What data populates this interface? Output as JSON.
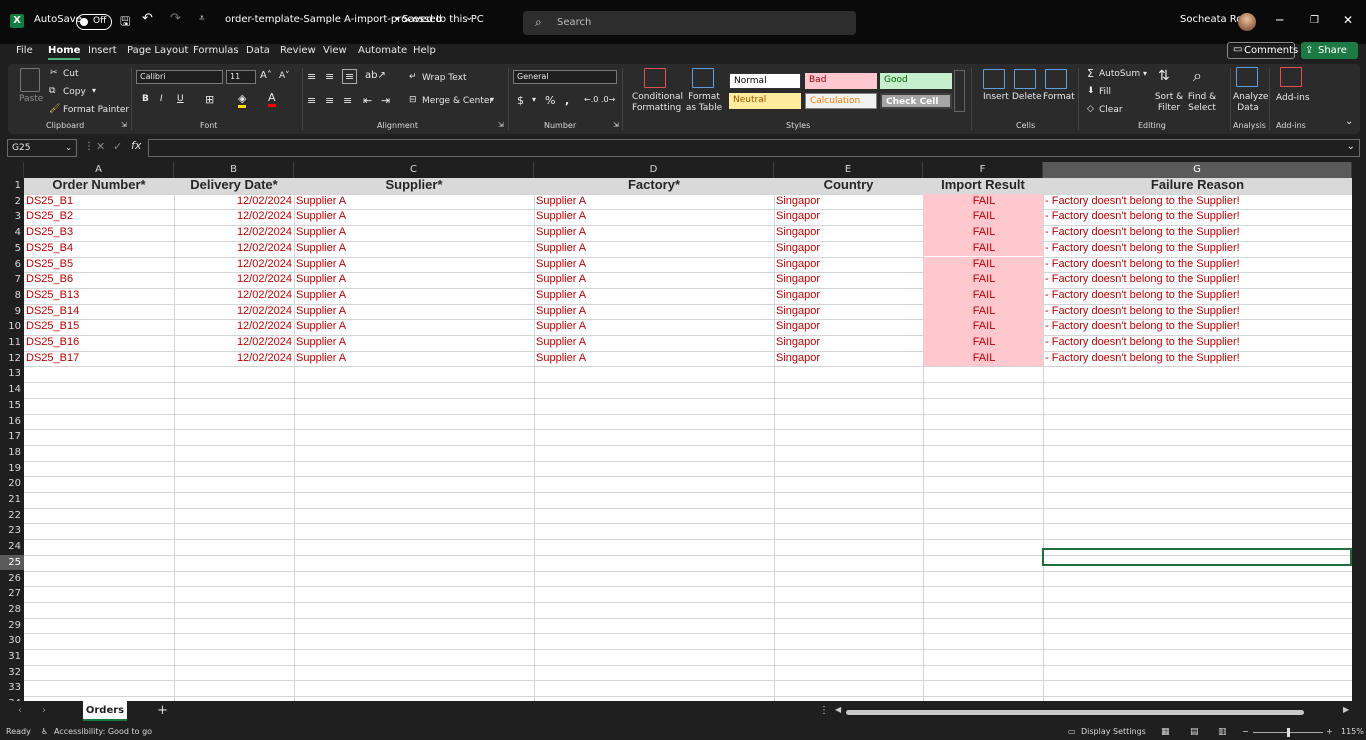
{
  "titlebar": {
    "autosave_label": "AutoSave",
    "autosave_state": "Off",
    "filename": "order-template-Sample A-import-processed",
    "save_status": "Saved to this PC",
    "search_placeholder": "Search",
    "user_name": "Socheata Rou"
  },
  "menu": {
    "tabs": [
      "File",
      "Home",
      "Insert",
      "Page Layout",
      "Formulas",
      "Data",
      "Review",
      "View",
      "Automate",
      "Help"
    ],
    "active_tab": "Home",
    "comments_label": "Comments",
    "share_label": "Share"
  },
  "ribbon": {
    "clipboard": {
      "paste": "Paste",
      "cut": "Cut",
      "copy": "Copy",
      "format_painter": "Format Painter",
      "label": "Clipboard"
    },
    "font": {
      "name": "Calibri",
      "size": "11",
      "label": "Font"
    },
    "alignment": {
      "wrap_text": "Wrap Text",
      "merge_center": "Merge & Center",
      "label": "Alignment"
    },
    "number": {
      "format": "General",
      "label": "Number"
    },
    "styles": {
      "conditional_formatting": "Conditional Formatting",
      "format_as_table": "Format as Table",
      "cells": [
        "Normal",
        "Bad",
        "Good",
        "Neutral",
        "Calculation",
        "Check Cell"
      ],
      "label": "Styles"
    },
    "cells_group": {
      "insert": "Insert",
      "delete": "Delete",
      "format": "Format",
      "label": "Cells"
    },
    "editing": {
      "autosum": "AutoSum",
      "fill": "Fill",
      "clear": "Clear",
      "sort_filter": "Sort & Filter",
      "find_select": "Find & Select",
      "label": "Editing"
    },
    "analysis": {
      "analyze_data": "Analyze Data",
      "label": "Analysis"
    },
    "addins": {
      "addins": "Add-ins",
      "label": "Add-ins"
    }
  },
  "formula_bar": {
    "name_box": "G25",
    "formula": ""
  },
  "sheet": {
    "columns": [
      "A",
      "B",
      "C",
      "D",
      "E",
      "F",
      "G"
    ],
    "selected_column": "G",
    "selected_row": 25,
    "headers": [
      "Order Number*",
      "Delivery Date*",
      "Supplier*",
      "Factory*",
      "Country",
      "Import Result",
      "Failure Reason"
    ],
    "rows": [
      [
        "DS25_B1",
        "12/02/2024",
        "Supplier A",
        "Supplier A",
        "Singapor",
        "FAIL",
        "- Factory doesn't belong to the Supplier!"
      ],
      [
        "DS25_B2",
        "12/02/2024",
        "Supplier A",
        "Supplier A",
        "Singapor",
        "FAIL",
        "- Factory doesn't belong to the Supplier!"
      ],
      [
        "DS25_B3",
        "12/02/2024",
        "Supplier A",
        "Supplier A",
        "Singapor",
        "FAIL",
        "- Factory doesn't belong to the Supplier!"
      ],
      [
        "DS25_B4",
        "12/02/2024",
        "Supplier A",
        "Supplier A",
        "Singapor",
        "FAIL",
        "- Factory doesn't belong to the Supplier!"
      ],
      [
        "DS25_B5",
        "12/02/2024",
        "Supplier A",
        "Supplier A",
        "Singapor",
        "FAIL",
        "- Factory doesn't belong to the Supplier!"
      ],
      [
        "DS25_B6",
        "12/02/2024",
        "Supplier A",
        "Supplier A",
        "Singapor",
        "FAIL",
        "- Factory doesn't belong to the Supplier!"
      ],
      [
        "DS25_B13",
        "12/02/2024",
        "Supplier A",
        "Supplier A",
        "Singapor",
        "FAIL",
        "- Factory doesn't belong to the Supplier!"
      ],
      [
        "DS25_B14",
        "12/02/2024",
        "Supplier A",
        "Supplier A",
        "Singapor",
        "FAIL",
        "- Factory doesn't belong to the Supplier!"
      ],
      [
        "DS25_B15",
        "12/02/2024",
        "Supplier A",
        "Supplier A",
        "Singapor",
        "FAIL",
        "- Factory doesn't belong to the Supplier!"
      ],
      [
        "DS25_B16",
        "12/02/2024",
        "Supplier A",
        "Supplier A",
        "Singapor",
        "FAIL",
        "- Factory doesn't belong to the Supplier!"
      ],
      [
        "DS25_B17",
        "12/02/2024",
        "Supplier A",
        "Supplier A",
        "Singapor",
        "FAIL",
        "- Factory doesn't belong to the Supplier!"
      ]
    ],
    "visible_row_count": 34
  },
  "sheet_tabs": {
    "tabs": [
      "Orders"
    ],
    "active": "Orders"
  },
  "status": {
    "ready": "Ready",
    "accessibility": "Accessibility: Good to go",
    "display_settings": "Display Settings",
    "zoom": "115%"
  },
  "colors": {
    "error_text": "#c00000",
    "fail_fill": "#ffc7ce",
    "header_fill": "#d9d9d9",
    "accent": "#107c41"
  }
}
